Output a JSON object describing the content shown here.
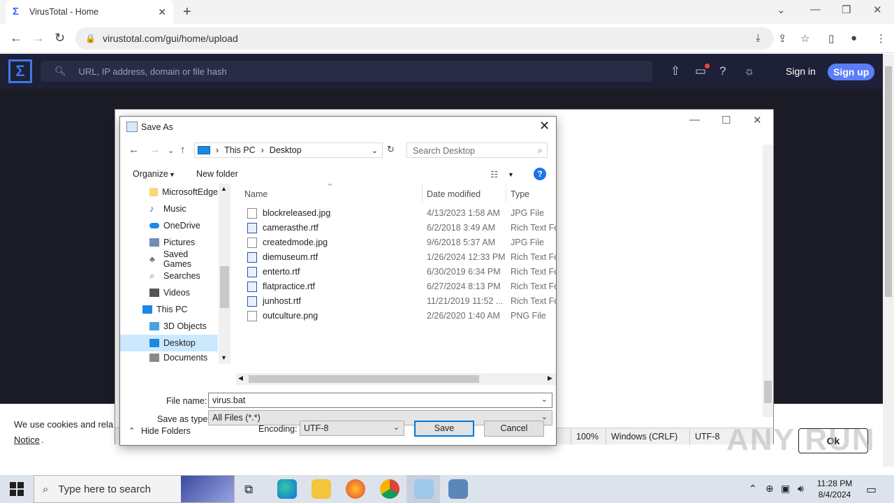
{
  "browser": {
    "tab_title": "VirusTotal - Home",
    "url": "virustotal.com/gui/home/upload"
  },
  "vt": {
    "search_placeholder": "URL, IP address, domain or file hash",
    "signin": "Sign in",
    "signup": "Sign up"
  },
  "cookie": {
    "text": "We use cookies and rela",
    "notice": "Notice",
    "notice_suffix": ".",
    "ok": "Ok",
    "watermark": "ANY RUN"
  },
  "notepad": {
    "status": {
      "zoom": "100%",
      "eol": "Windows (CRLF)",
      "encoding": "UTF-8"
    }
  },
  "dialog": {
    "title": "Save As",
    "breadcrumb": [
      "This PC",
      "Desktop"
    ],
    "search_placeholder": "Search Desktop",
    "organize": "Organize",
    "new_folder": "New folder",
    "help": "?",
    "tree": [
      {
        "label": "MicrosoftEdge",
        "icon": "folder-icon",
        "color": "#f8d775"
      },
      {
        "label": "Music",
        "icon": "music-icon",
        "color": "#1e6fd9"
      },
      {
        "label": "OneDrive",
        "icon": "cloud-icon",
        "color": "#1e88e5"
      },
      {
        "label": "Pictures",
        "icon": "pictures-icon",
        "color": "#6f8fb3"
      },
      {
        "label": "Saved Games",
        "icon": "games-icon",
        "color": "#6d6d6d"
      },
      {
        "label": "Searches",
        "icon": "search-folder-icon",
        "color": "#6d6d6d"
      },
      {
        "label": "Videos",
        "icon": "videos-icon",
        "color": "#555555"
      },
      {
        "label": "This PC",
        "icon": "computer-icon",
        "color": "#1e88e5"
      },
      {
        "label": "3D Objects",
        "icon": "3d-objects-icon",
        "color": "#4aa3df"
      },
      {
        "label": "Desktop",
        "icon": "desktop-icon",
        "color": "#1e88e5"
      },
      {
        "label": "Documents",
        "icon": "documents-icon",
        "color": "#8a8a8a"
      }
    ],
    "columns": {
      "name": "Name",
      "date": "Date modified",
      "type": "Type"
    },
    "files": [
      {
        "name": "blockreleased.jpg",
        "date": "4/13/2023 1:58 AM",
        "type": "JPG File",
        "kind": "image"
      },
      {
        "name": "camerasthe.rtf",
        "date": "6/2/2018 3:49 AM",
        "type": "Rich Text For",
        "kind": "rtf"
      },
      {
        "name": "createdmode.jpg",
        "date": "9/6/2018 5:37 AM",
        "type": "JPG File",
        "kind": "image"
      },
      {
        "name": "diemuseum.rtf",
        "date": "1/26/2024 12:33 PM",
        "type": "Rich Text For",
        "kind": "rtf"
      },
      {
        "name": "enterto.rtf",
        "date": "6/30/2019 6:34 PM",
        "type": "Rich Text For",
        "kind": "rtf"
      },
      {
        "name": "flatpractice.rtf",
        "date": "6/27/2024 8:13 PM",
        "type": "Rich Text For",
        "kind": "rtf"
      },
      {
        "name": "junhost.rtf",
        "date": "11/21/2019 11:52 ...",
        "type": "Rich Text For",
        "kind": "rtf"
      },
      {
        "name": "outculture.png",
        "date": "2/26/2020 1:40 AM",
        "type": "PNG File",
        "kind": "image"
      }
    ],
    "file_name_label": "File name:",
    "file_name_value": "virus.bat",
    "save_type_label": "Save as type:",
    "save_type_value": "All Files  (*.*)",
    "hide_folders": "Hide Folders",
    "encoding_label": "Encoding:",
    "encoding_value": "UTF-8",
    "save": "Save",
    "cancel": "Cancel"
  },
  "taskbar": {
    "search_placeholder": "Type here to search",
    "time": "11:28 PM",
    "date": "8/4/2024"
  }
}
